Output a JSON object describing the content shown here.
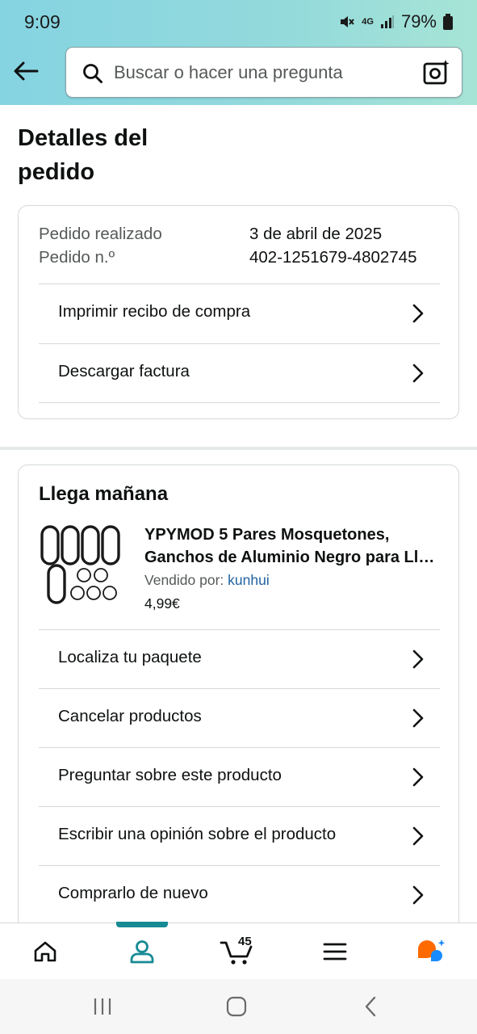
{
  "status_bar": {
    "time": "9:09",
    "battery": "79%",
    "network": "4G"
  },
  "search": {
    "placeholder": "Buscar o hacer una pregunta"
  },
  "icons": {
    "back": "arrow-left-icon",
    "search": "search-icon",
    "camera": "camera-sparkle-icon",
    "chevron": "chevron-right-icon"
  },
  "page": {
    "title": "Detalles del pedido"
  },
  "order": {
    "placed_label": "Pedido realizado",
    "placed_value": "3 de abril de 2025",
    "number_label": "Pedido n.º",
    "number_value": "402-1251679-4802745",
    "links": [
      {
        "label": "Imprimir recibo de compra"
      },
      {
        "label": "Descargar factura"
      }
    ]
  },
  "shipment": {
    "heading": "Llega mañana",
    "product": {
      "title_line1": "YPYMOD 5 Pares Mosquetones,",
      "title_line2": "Ganchos de Aluminio Negro para Llaves",
      "sold_by_label": "Vendido por:",
      "seller": "kunhui",
      "price": "4,99€"
    },
    "actions": [
      {
        "label": "Localiza tu paquete"
      },
      {
        "label": "Cancelar productos"
      },
      {
        "label": "Preguntar sobre este producto"
      },
      {
        "label": "Escribir una opinión sobre el producto"
      },
      {
        "label": "Comprarlo de nuevo"
      }
    ]
  },
  "bottom_nav": {
    "cart_count": "45",
    "active": "account"
  },
  "colors": {
    "header_start": "#85d4e2",
    "header_end": "#a6e4d6",
    "accent": "#178a94",
    "link": "#2162a1",
    "rufus_orange": "#ff6a00",
    "rufus_blue": "#1a8cff"
  }
}
